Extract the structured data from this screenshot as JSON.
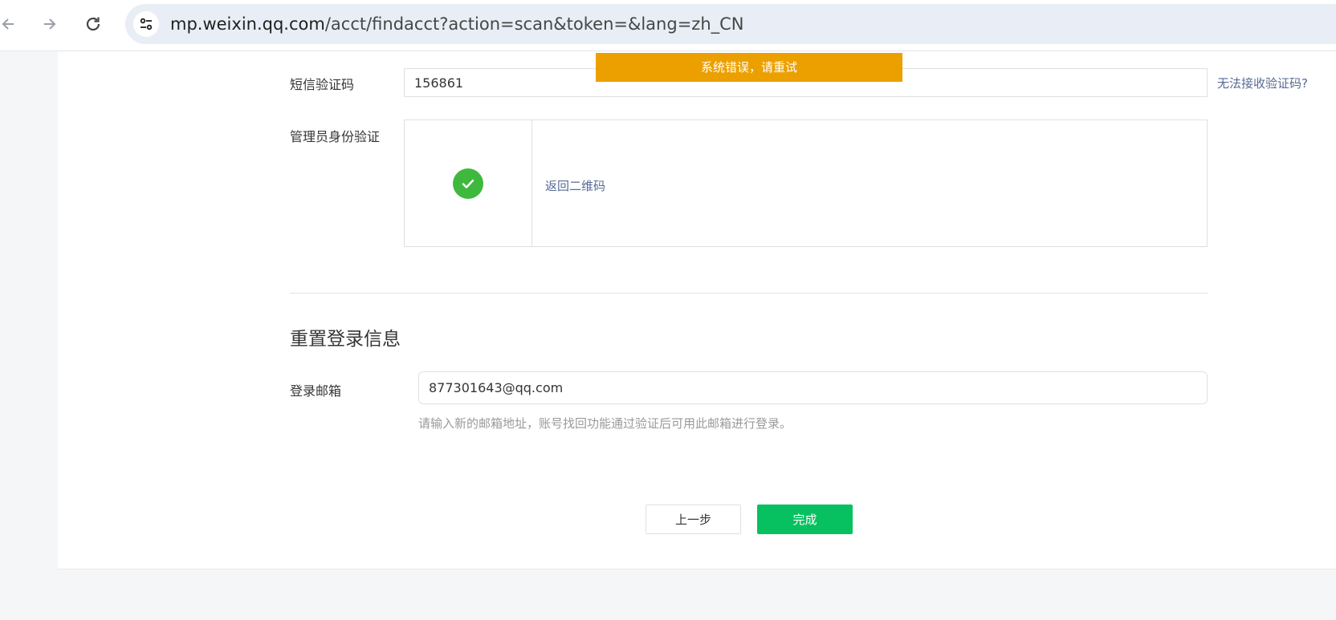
{
  "browser": {
    "url_host": "mp.weixin.qq.com",
    "url_path": "/acct/findacct?action=scan&token=&lang=zh_CN",
    "icons": {
      "back": "arrow-left-icon",
      "forward": "arrow-right-icon",
      "reload": "reload-icon",
      "site_info": "tune-icon"
    }
  },
  "toast": {
    "message": "系统错误，请重试",
    "color": "#eba000"
  },
  "sms": {
    "label": "短信验证码",
    "value": "156861",
    "help_link": "无法接收验证码?"
  },
  "admin_verify": {
    "label": "管理员身份验证",
    "status_icon": "check-circle-icon",
    "back_link": "返回二维码"
  },
  "reset": {
    "title": "重置登录信息",
    "email_label": "登录邮箱",
    "email_value": "877301643@qq.com",
    "hint": "请输入新的邮箱地址，账号找回功能通过验证后可用此邮箱进行登录。"
  },
  "actions": {
    "prev_label": "上一步",
    "done_label": "完成",
    "primary_color": "#07c160",
    "link_color": "#576b95"
  }
}
